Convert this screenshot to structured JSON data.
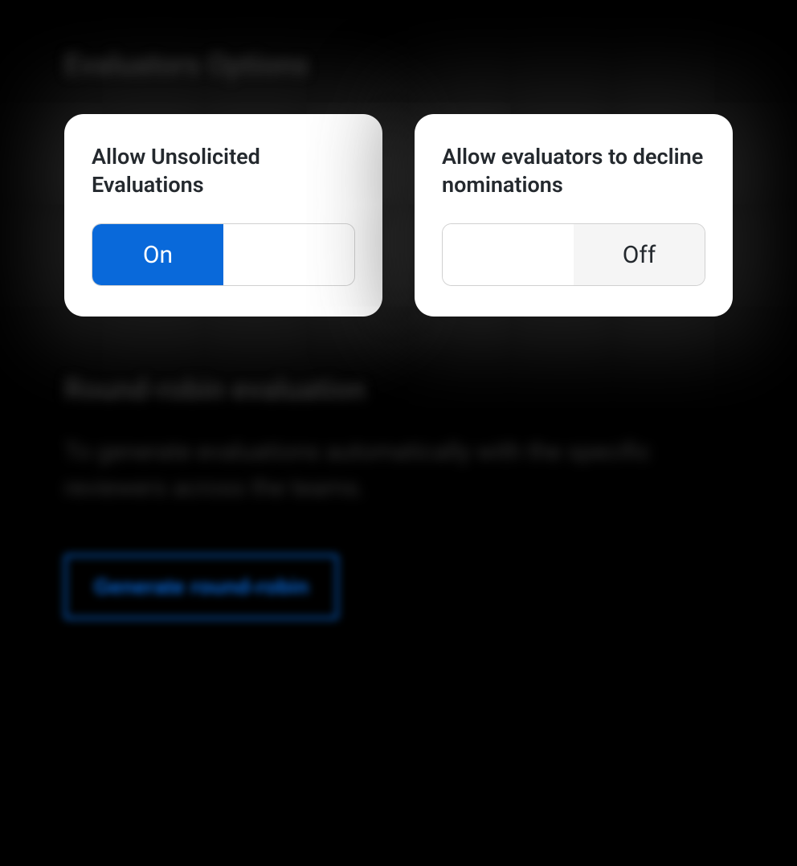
{
  "section1": {
    "heading": "Evaluators Options"
  },
  "cards": [
    {
      "title": "Allow Unsolicited Evaluations",
      "state": "on",
      "on_label": "On",
      "off_label": ""
    },
    {
      "title": "Allow evaluators to decline nominations",
      "state": "off",
      "on_label": "",
      "off_label": "Off"
    }
  ],
  "section2": {
    "heading": "Round-robin evaluation",
    "description": "To generate evaluations automatically with the specific reviewers across the teams."
  },
  "button": {
    "label": "Generate round-robin"
  }
}
